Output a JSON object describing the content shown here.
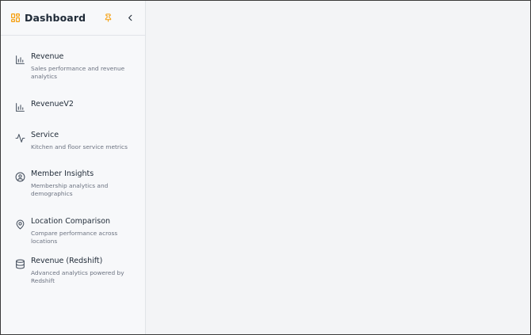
{
  "app": {
    "title": "Dashboard"
  },
  "icons": {
    "logo": "dashboard-grid-icon",
    "pin": "pin-icon",
    "collapse": "chevron-left-icon"
  },
  "colors": {
    "accent": "#f59e0b",
    "text": "#1f2a37",
    "muted": "#6b7280",
    "sidebar_bg": "#f7f8fa",
    "main_bg": "#f3f4f6"
  },
  "sidebar": {
    "items": [
      {
        "label": "Revenue",
        "description": "Sales performance and revenue analytics",
        "icon": "bar-chart-icon"
      },
      {
        "label": "RevenueV2",
        "description": "",
        "icon": "bar-chart-icon"
      },
      {
        "label": "Service",
        "description": "Kitchen and floor service metrics",
        "icon": "activity-icon"
      },
      {
        "label": "Member Insights",
        "description": "Membership analytics and demographics",
        "icon": "user-circle-icon"
      },
      {
        "label": "Location Comparison",
        "description": "Compare performance across locations",
        "icon": "map-pin-icon"
      },
      {
        "label": "Revenue (Redshift)",
        "description": "Advanced analytics powered by Redshift",
        "icon": "database-icon"
      }
    ]
  }
}
